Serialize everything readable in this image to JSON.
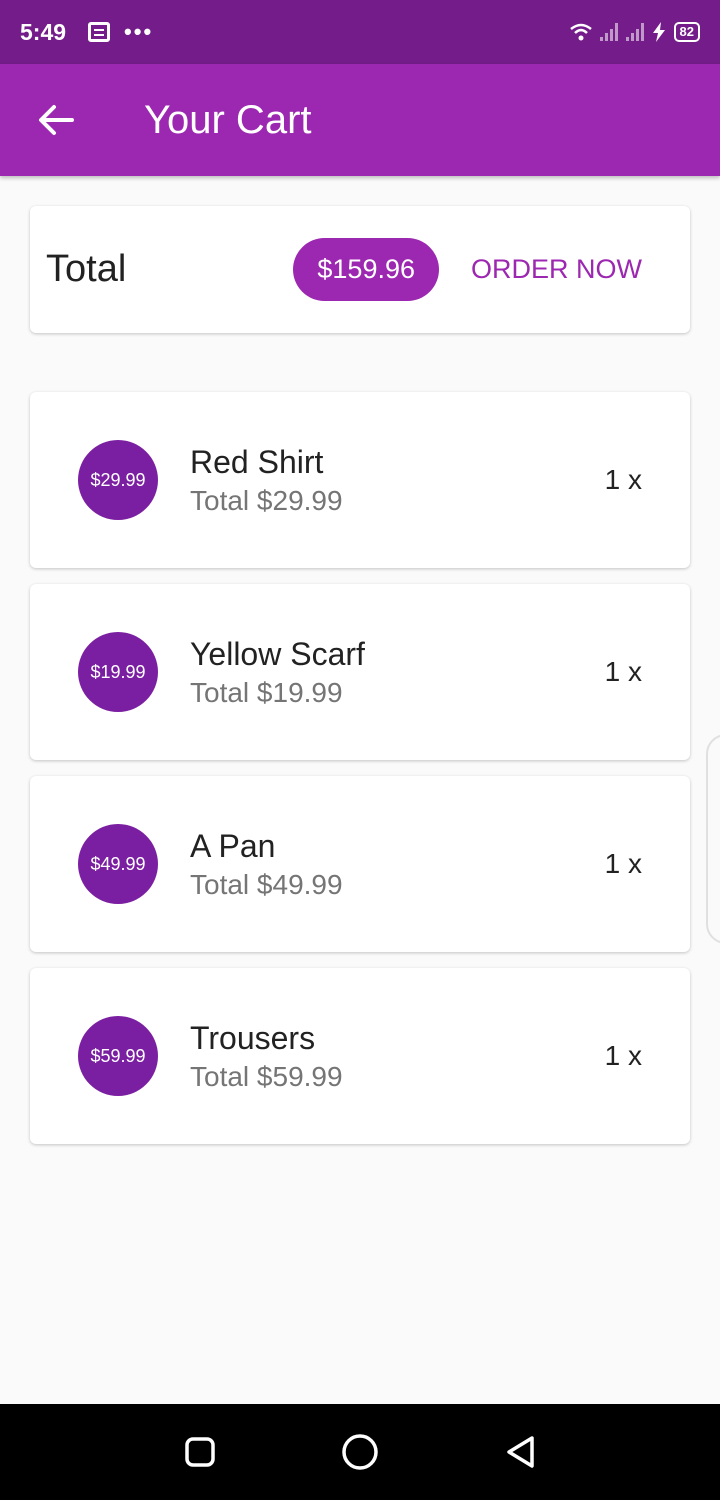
{
  "status_bar": {
    "time": "5:49",
    "dots": "•••",
    "battery": "82"
  },
  "app_bar": {
    "title": "Your Cart"
  },
  "summary": {
    "label": "Total",
    "amount": "$159.96",
    "order_button": "ORDER NOW"
  },
  "items": [
    {
      "price": "$29.99",
      "name": "Red Shirt",
      "total": "Total $29.99",
      "qty": "1 x"
    },
    {
      "price": "$19.99",
      "name": "Yellow Scarf",
      "total": "Total $19.99",
      "qty": "1 x"
    },
    {
      "price": "$49.99",
      "name": "A Pan",
      "total": "Total $49.99",
      "qty": "1 x"
    },
    {
      "price": "$59.99",
      "name": "Trousers",
      "total": "Total $59.99",
      "qty": "1 x"
    }
  ],
  "colors": {
    "primary": "#9c27b0",
    "status_bar": "#741d8a",
    "avatar": "#7b1fa2"
  },
  "icons": {
    "back": "arrow-back-icon",
    "notification": "notification-icon",
    "wifi": "wifi-icon",
    "signal": "signal-icon",
    "charging": "charging-icon",
    "recents": "recents-square-icon",
    "home": "home-circle-icon",
    "back_nav": "back-triangle-icon"
  }
}
